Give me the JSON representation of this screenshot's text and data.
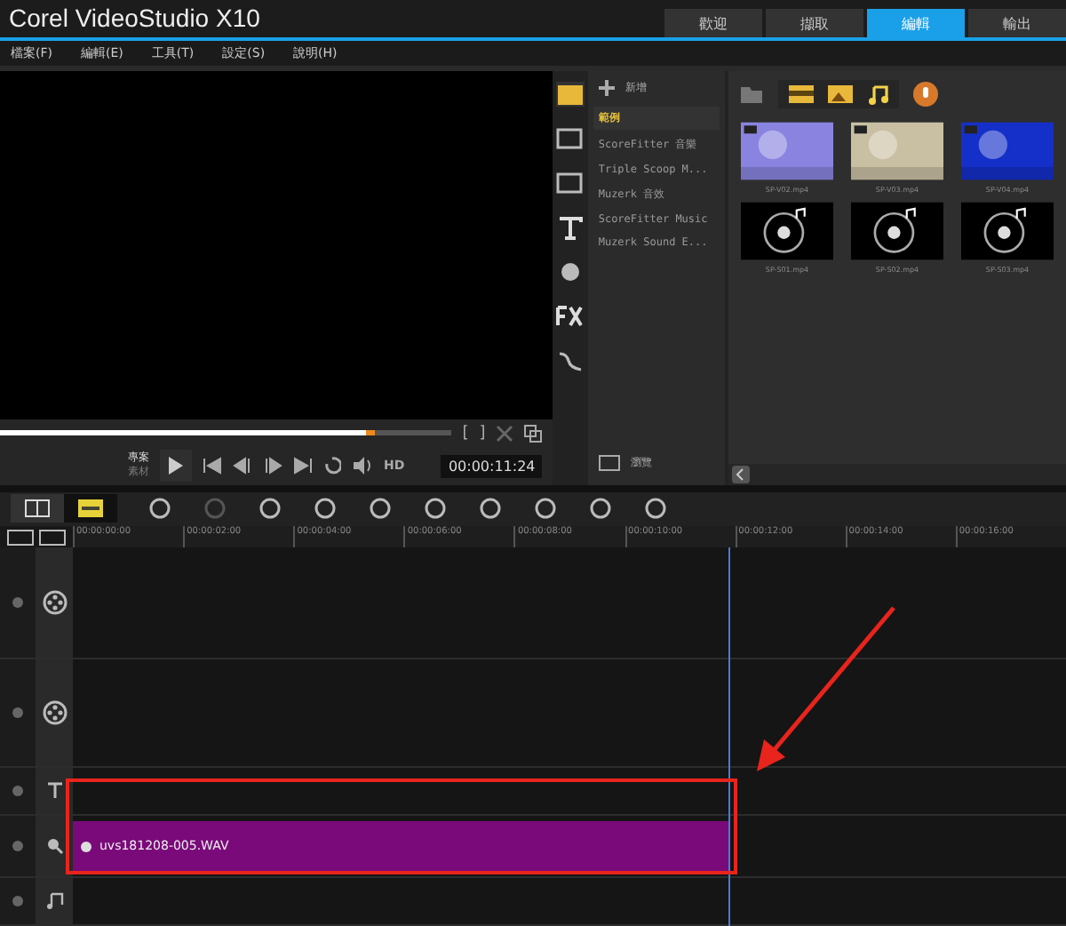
{
  "app_title": "Corel VideoStudio X10",
  "tabs": [
    {
      "label": "歡迎",
      "selected": false
    },
    {
      "label": "擷取",
      "selected": false
    },
    {
      "label": "編輯",
      "selected": true
    },
    {
      "label": "輸出",
      "selected": false
    }
  ],
  "menu": [
    "檔案(F)",
    "編輯(E)",
    "工具(T)",
    "設定(S)",
    "說明(H)"
  ],
  "player": {
    "scrubber": {
      "level": 0.81
    },
    "mode_labels": [
      "專案",
      "素材"
    ],
    "hd": "HD",
    "timecode": "00:00:11:24",
    "mark_in": "[",
    "mark_out": "]"
  },
  "library": {
    "add_label": "新增",
    "browse_label": "瀏覽",
    "folders": [
      {
        "label": "範例",
        "selected": true
      },
      {
        "label": "ScoreFitter 音樂",
        "selected": false
      },
      {
        "label": "Triple Scoop M...",
        "selected": false
      },
      {
        "label": "Muzerk 音效",
        "selected": false
      },
      {
        "label": "ScoreFitter Music",
        "selected": false
      },
      {
        "label": "Muzerk Sound E...",
        "selected": false
      }
    ],
    "media": [
      {
        "kind": "video",
        "name": "SP-V02.mp4",
        "color": "#8a84e0"
      },
      {
        "kind": "video",
        "name": "SP-V03.mp4",
        "color": "#c9c0a4"
      },
      {
        "kind": "video",
        "name": "SP-V04.mp4",
        "color": "#1530c8"
      },
      {
        "kind": "audio",
        "name": "SP-S01.mp4"
      },
      {
        "kind": "audio",
        "name": "SP-S02.mp4"
      },
      {
        "kind": "audio",
        "name": "SP-S03.mp4"
      }
    ]
  },
  "timeline": {
    "ruler": [
      "00:00:00:00",
      "00:00:02:00",
      "00:00:04:00",
      "00:00:06:00",
      "00:00:08:00",
      "00:00:10:00",
      "00:00:12:00",
      "00:00:14:00",
      "00:00:16:00"
    ],
    "tracks": [
      {
        "kind": "video"
      },
      {
        "kind": "overlay"
      },
      {
        "kind": "title"
      },
      {
        "kind": "voice",
        "clip": {
          "name": "uvs181208-005.WAV"
        }
      },
      {
        "kind": "music"
      }
    ]
  }
}
